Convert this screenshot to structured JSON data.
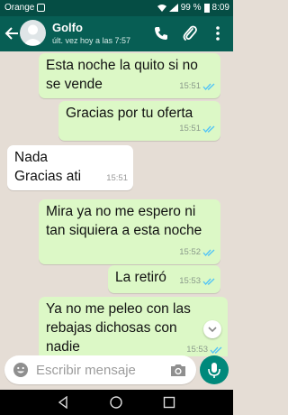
{
  "status_bar": {
    "carrier": "Orange",
    "battery": "99 %",
    "time": "8:09"
  },
  "header": {
    "contact_name": "Golfo",
    "last_seen": "últ. vez hoy a las 7:57"
  },
  "messages": [
    {
      "direction": "out",
      "text": "Esta noche la quito si no se vende",
      "time": "15:51",
      "status": "read"
    },
    {
      "direction": "out",
      "text": "Gracias por tu oferta",
      "time": "15:51",
      "status": "read"
    },
    {
      "direction": "in",
      "text": "Nada Gracias ati",
      "time": "15:51"
    },
    {
      "direction": "out",
      "text": "Mira ya no me espero ni tan siquiera a esta noche",
      "time": "15:52",
      "status": "read"
    },
    {
      "direction": "out",
      "text": "La retiró",
      "time": "15:53",
      "status": "read"
    },
    {
      "direction": "out",
      "text": "Ya no me peleo con las rebajas dichosas con nadie",
      "time": "15:53",
      "status": "read"
    }
  ],
  "composer": {
    "placeholder": "Escribir mensaje"
  },
  "colors": {
    "header": "#075e54",
    "status_bar": "#054d44",
    "outgoing": "#dcf8c6",
    "incoming": "#ffffff",
    "background": "#e5ddd5",
    "read_tick": "#4fc3f7",
    "mic": "#00897b"
  },
  "icons": [
    "back-icon",
    "call-icon",
    "attach-icon",
    "more-icon",
    "emoji-icon",
    "camera-icon",
    "mic-icon",
    "scroll-down-icon",
    "nav-back-icon",
    "nav-home-icon",
    "nav-recents-icon"
  ]
}
